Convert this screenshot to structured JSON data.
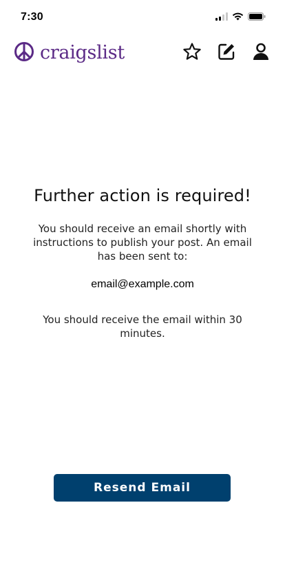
{
  "status_bar": {
    "time": "7:30",
    "icons": [
      "cellular-signal-icon",
      "wifi-icon",
      "battery-icon"
    ]
  },
  "header": {
    "logo_text": "craigslist",
    "logo_icon": "peace-sign-icon",
    "actions": [
      {
        "icon": "star-icon"
      },
      {
        "icon": "edit-icon"
      },
      {
        "icon": "user-icon"
      }
    ]
  },
  "main": {
    "title": "Further action is required!",
    "instructions": "You should receive an email shortly with instructions to publish your post. An email has been sent to:",
    "email": "email@example.com",
    "time_note": "You should receive the email within 30 minutes."
  },
  "actions": {
    "resend_label": "Resend Email"
  },
  "colors": {
    "brand": "#5b2a86",
    "button": "#00406e"
  }
}
